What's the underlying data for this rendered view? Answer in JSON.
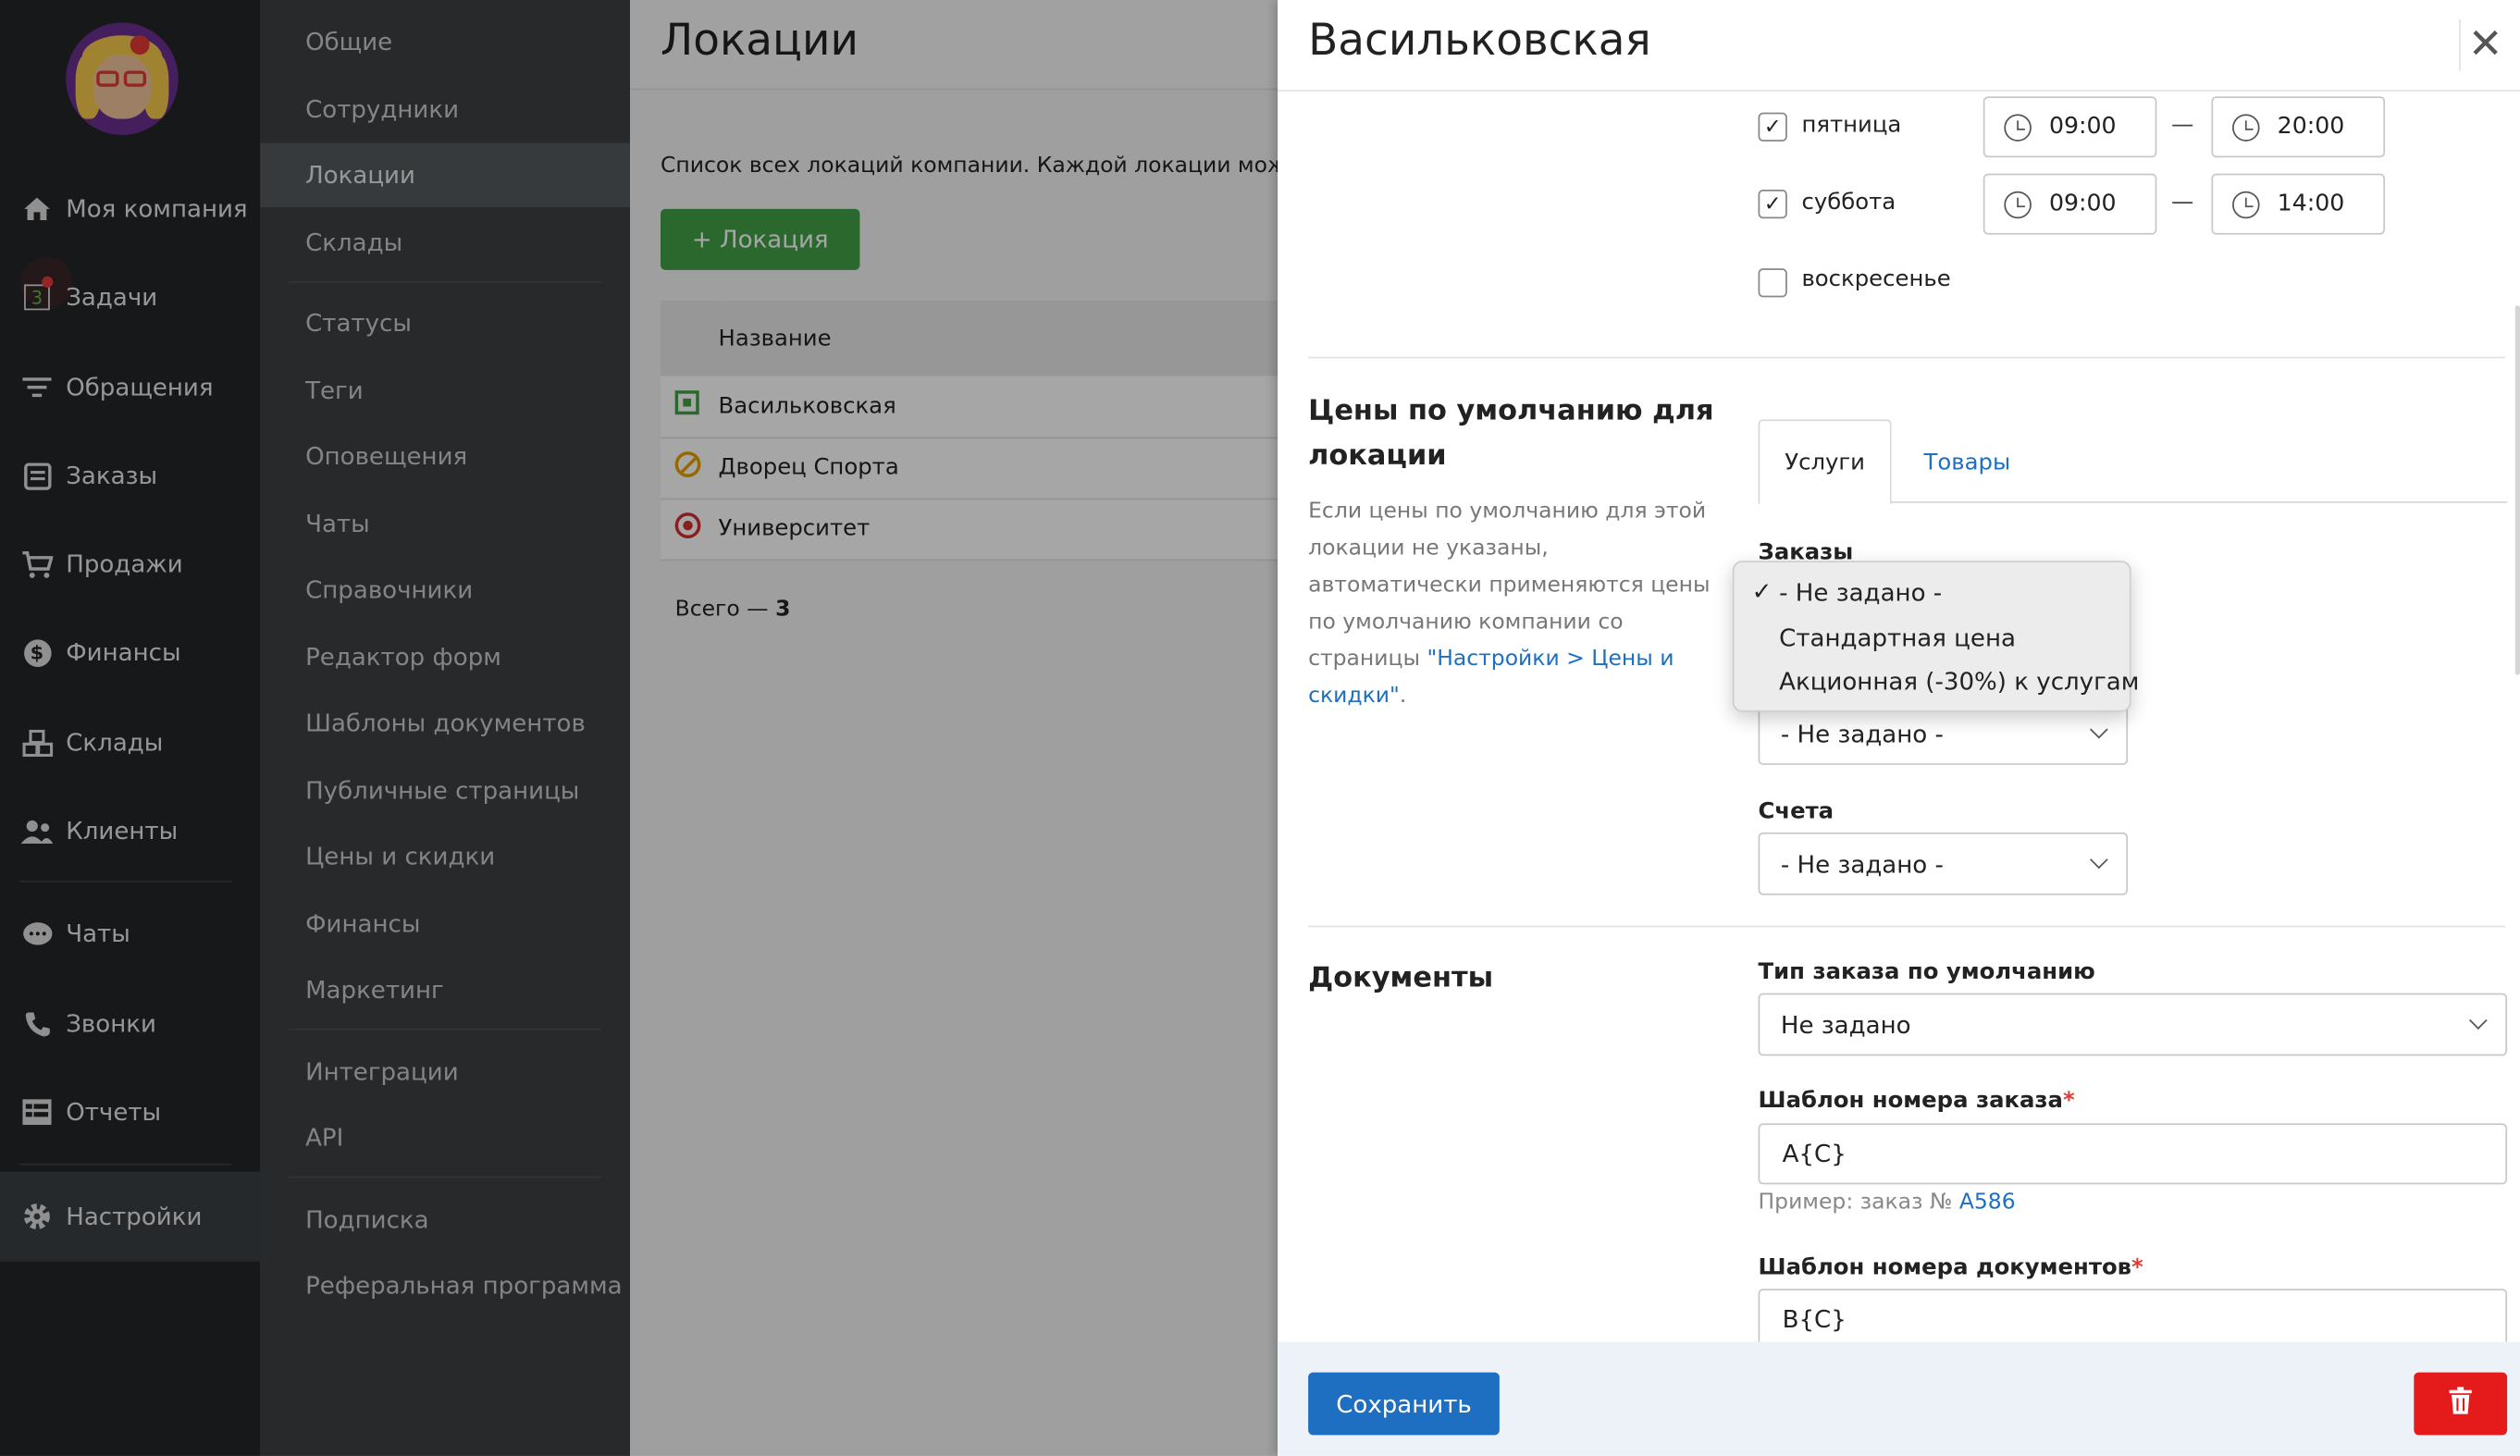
{
  "nav_main": {
    "items": [
      {
        "label": "Моя компания",
        "icon": "home-icon"
      },
      {
        "label": "Задачи",
        "icon": "tasks-icon",
        "badge": "3"
      },
      {
        "label": "Обращения",
        "icon": "funnel-icon"
      },
      {
        "label": "Заказы",
        "icon": "orders-icon"
      },
      {
        "label": "Продажи",
        "icon": "cart-icon"
      },
      {
        "label": "Финансы",
        "icon": "dollar-icon"
      },
      {
        "label": "Склады",
        "icon": "boxes-icon"
      },
      {
        "label": "Клиенты",
        "icon": "users-icon"
      },
      {
        "label": "Чаты",
        "icon": "chat-icon"
      },
      {
        "label": "Звонки",
        "icon": "phone-icon"
      },
      {
        "label": "Отчеты",
        "icon": "reports-icon"
      },
      {
        "label": "Настройки",
        "icon": "gear-icon"
      }
    ]
  },
  "nav_settings": {
    "items": [
      "Общие",
      "Сотрудники",
      "Локации",
      "Склады",
      "Статусы",
      "Теги",
      "Оповещения",
      "Чаты",
      "Справочники",
      "Редактор форм",
      "Шаблоны документов",
      "Публичные страницы",
      "Цены и скидки",
      "Финансы",
      "Маркетинг",
      "Интеграции",
      "API",
      "Подписка",
      "Реферальная программа"
    ]
  },
  "main": {
    "title": "Локации",
    "description": "Список всех локаций компании. Каждой локации можно",
    "add_button": "+ Локация",
    "table": {
      "header": "Название",
      "rows": [
        "Васильковская",
        "Дворец Спорта",
        "Университет"
      ]
    },
    "total_label": "Всего — ",
    "total_value": "3"
  },
  "panel": {
    "title": "Васильковская",
    "schedule": [
      {
        "day": "пятница",
        "checked": true,
        "from": "09:00",
        "to": "20:00"
      },
      {
        "day": "суббота",
        "checked": true,
        "from": "09:00",
        "to": "14:00"
      },
      {
        "day": "воскресенье",
        "checked": false
      }
    ],
    "prices": {
      "section_title": "Цены по умолчанию для локации",
      "note_text": "Если цены по умолчанию для этой локации не указаны, автоматически применяются цены по умолчанию компании со страницы ",
      "note_link": "\"Настройки > Цены и скидки\"",
      "note_end": ".",
      "tabs": [
        "Услуги",
        "Товары"
      ],
      "orders_label": "Заказы",
      "second_select": "- Не задано -",
      "invoices_label": "Счета",
      "invoices_value": "- Не задано -",
      "dropdown_options": [
        "- Не задано -",
        "Стандартная цена",
        "Акционная (-30%) к услугам"
      ]
    },
    "documents": {
      "section_title": "Документы",
      "order_type_label": "Тип заказа по умолчанию",
      "order_type_value": "Не задано",
      "order_tpl_label": "Шаблон номера заказа",
      "order_tpl_value": "A{C}",
      "order_tpl_hint": "Пример: заказ № ",
      "order_tpl_example": "A586",
      "doc_tpl_label": "Шаблон номера документов",
      "doc_tpl_value": "B{C}"
    },
    "save_button": "Сохранить"
  },
  "colors": {
    "primary": "#1e6fc2",
    "success": "#43a047",
    "danger": "#e51a1a"
  }
}
